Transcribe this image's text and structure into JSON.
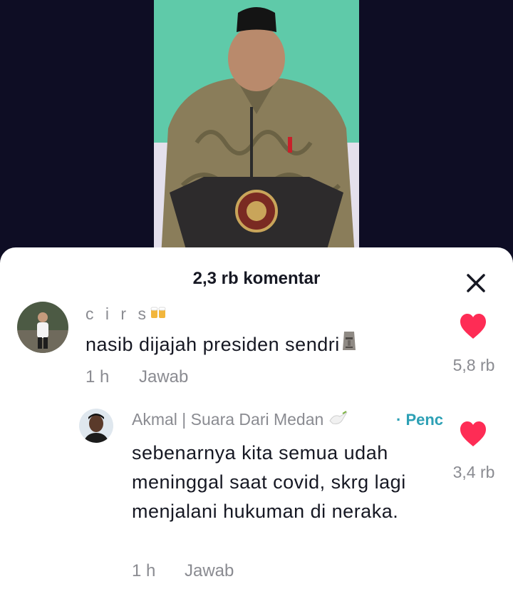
{
  "video": {
    "background_color": "#0e0d24"
  },
  "sheet": {
    "title": "2,3 rb komentar",
    "close_icon": "close-icon"
  },
  "comments": [
    {
      "username": "c i r s",
      "username_emoji": "beer-mugs-emoji",
      "text": "nasib dijajah presiden sendri",
      "text_emoji": "moai-emoji",
      "time": "1 h",
      "reply_label": "Jawab",
      "likes": "5,8 rb",
      "heart_color": "#fe2c55"
    },
    {
      "username": "Akmal | Suara Dari Medan",
      "username_emoji": "dove-emoji",
      "reply_tag": "· Penc",
      "text": "sebenarnya kita semua udah meninggal saat covid, skrg lagi menjalani hukuman di neraka.",
      "time": "1 h",
      "reply_label": "Jawab",
      "likes": "3,4 rb",
      "heart_color": "#fe2c55"
    }
  ]
}
